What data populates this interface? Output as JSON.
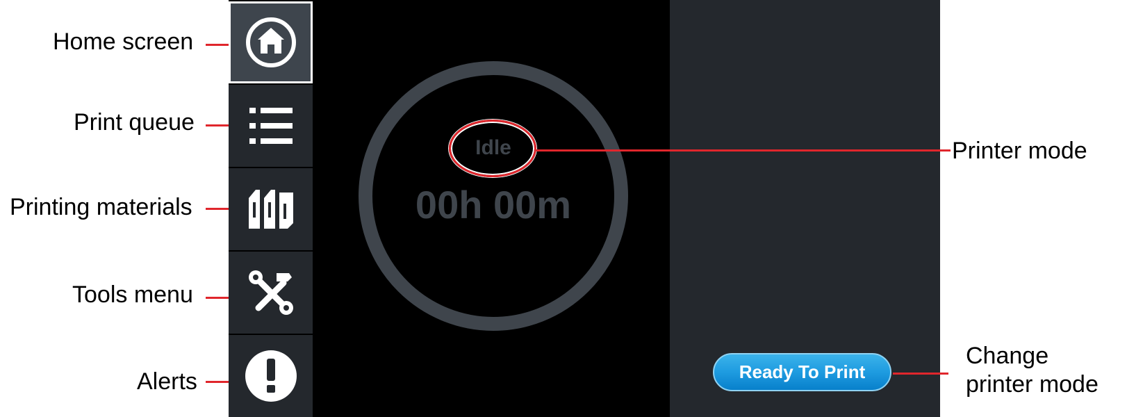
{
  "callouts": {
    "home": "Home screen",
    "queue": "Print queue",
    "materials": "Printing materials",
    "tools": "Tools menu",
    "alerts": "Alerts",
    "printer_mode": "Printer mode",
    "change_mode_line1": "Change",
    "change_mode_line2": "printer mode"
  },
  "sidebar": {
    "items": [
      {
        "icon": "home-icon",
        "active": true
      },
      {
        "icon": "list-icon"
      },
      {
        "icon": "materials-icon"
      },
      {
        "icon": "tools-icon"
      },
      {
        "icon": "alert-icon"
      }
    ]
  },
  "status": {
    "mode": "Idle",
    "time": "00h 00m"
  },
  "actions": {
    "ready_label": "Ready To Print"
  },
  "colors": {
    "accent_red": "#e0262c",
    "button_blue": "#1e9be0",
    "ring": "#3f454c",
    "sidebar": "#24282d"
  }
}
